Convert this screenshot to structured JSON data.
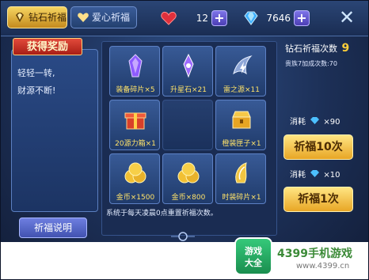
{
  "tabs": {
    "diamond": "钻石祈福",
    "heart": "爱心祈福"
  },
  "resources": {
    "hearts": "12",
    "gems": "7646",
    "plus": "+"
  },
  "close": "✕",
  "reward": {
    "title": "获得奖励",
    "line1": "轻轻一转,",
    "line2": "财源不断!"
  },
  "rules_button": "祈福说明",
  "grid": {
    "items": [
      {
        "label": "装备碎片×5",
        "icon": "purple-crystal-icon"
      },
      {
        "label": "升星石×21",
        "icon": "star-stone-icon"
      },
      {
        "label": "雷之源×11",
        "icon": "thunder-source-icon"
      },
      {
        "label": "20源力箱×1",
        "icon": "red-gift-box-icon"
      },
      {
        "label": "",
        "icon": ""
      },
      {
        "label": "橙装匣子×1",
        "icon": "orange-chest-icon"
      },
      {
        "label": "金币×1500",
        "icon": "gold-coins-icon"
      },
      {
        "label": "金币×800",
        "icon": "gold-coins-icon"
      },
      {
        "label": "时装碎片×1",
        "icon": "fashion-shard-icon"
      }
    ],
    "note": "系统于每天凌晨0点重置祈福次数。"
  },
  "count": {
    "label": "钻石祈福次数",
    "value": "9"
  },
  "vip_note": "贵族7加成次数:70",
  "ten": {
    "cost_prefix": "消耗",
    "cost": "×90",
    "button": "祈福10次"
  },
  "one": {
    "cost_prefix": "消耗",
    "cost": "×10",
    "button": "祈福1次"
  },
  "footer": {
    "logo_top": "游戏",
    "logo_bottom": "大全",
    "brand": "4399手机游戏",
    "url": "www.4399.cn"
  },
  "colors": {
    "gold": "#ffcf3a",
    "label_yellow": "#ffe36a",
    "panel": "#1c3463"
  }
}
